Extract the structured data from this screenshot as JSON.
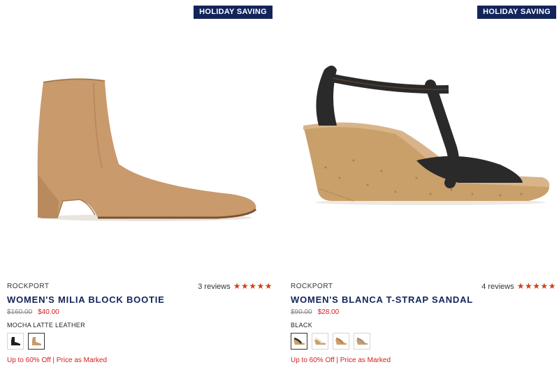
{
  "products": [
    {
      "badge": "HOLIDAY SAVING",
      "brand": "ROCKPORT",
      "reviews_text": "3 reviews",
      "rating_stars": 5,
      "name": "WOMEN'S MILIA BLOCK BOOTIE",
      "original_price": "$160.00",
      "sale_price": "$40.00",
      "color_name": "MOCHA LATTE LEATHER",
      "swatches": [
        {
          "icon": "black-bootie-swatch",
          "color": "#1e1e1e",
          "selected": false
        },
        {
          "icon": "tan-bootie-swatch",
          "color": "#c99a6c",
          "selected": true
        }
      ],
      "promo_text": "Up to 60% Off | Price as Marked",
      "image_icon": "tan-ankle-bootie-image"
    },
    {
      "badge": "HOLIDAY SAVING",
      "brand": "ROCKPORT",
      "reviews_text": "4 reviews",
      "rating_stars": 5,
      "name": "WOMEN'S BLANCA T-STRAP SANDAL",
      "original_price": "$90.00",
      "sale_price": "$28.00",
      "color_name": "BLACK",
      "swatches": [
        {
          "icon": "black-sandal-swatch",
          "color": "#2a2a2a",
          "selected": true
        },
        {
          "icon": "white-sandal-swatch",
          "color": "#e9e3da",
          "selected": false
        },
        {
          "icon": "tan-sandal-swatch",
          "color": "#c79a6c",
          "selected": false
        },
        {
          "icon": "taupe-sandal-swatch",
          "color": "#9e8f80",
          "selected": false
        }
      ],
      "promo_text": "Up to 60% Off | Price as Marked",
      "image_icon": "black-t-strap-wedge-sandal-image"
    }
  ],
  "colors": {
    "badge_bg": "#12245a",
    "name_color": "#12245a",
    "sale_red": "#d21f1f",
    "star_color": "#c8441d"
  }
}
